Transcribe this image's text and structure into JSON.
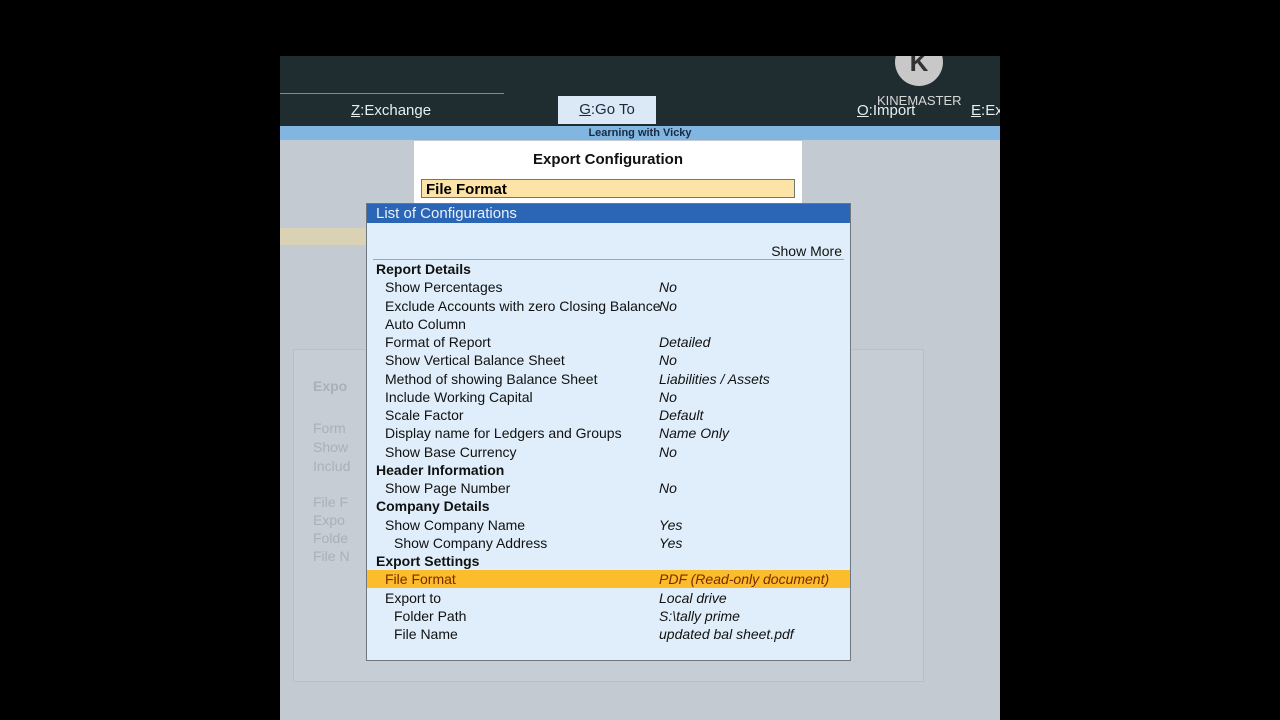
{
  "topbar": {
    "exchange_key": "Z",
    "exchange_label": "Exchange",
    "goto_key": "G",
    "goto_label": "Go To",
    "import_key": "O",
    "import_label": "Import",
    "e_key": "E",
    "e_label": "Ex"
  },
  "watermark": "KINEMASTER",
  "strip_title": "Learning with Vicky",
  "export_config": {
    "title": "Export Configuration",
    "field": "File Format"
  },
  "background_fragments": [
    "Expo",
    "Form",
    "Show",
    "Includ",
    "File F",
    "Expo",
    "Folde",
    "File N"
  ],
  "list": {
    "title": "List of Configurations",
    "show_more": "Show More",
    "rows": [
      {
        "k": "Report Details",
        "v": "",
        "type": "h"
      },
      {
        "k": "Show Percentages",
        "v": "No"
      },
      {
        "k": "Exclude Accounts with zero Closing Balance",
        "v": "No"
      },
      {
        "k": "Auto Column",
        "v": ""
      },
      {
        "k": "Format of Report",
        "v": "Detailed"
      },
      {
        "k": "Show Vertical Balance Sheet",
        "v": "No"
      },
      {
        "k": "Method of showing Balance Sheet",
        "v": "Liabilities / Assets"
      },
      {
        "k": "Include Working Capital",
        "v": "No"
      },
      {
        "k": "Scale Factor",
        "v": "Default"
      },
      {
        "k": "Display name for Ledgers and Groups",
        "v": "Name Only"
      },
      {
        "k": "Show Base Currency",
        "v": "No"
      },
      {
        "k": "Header Information",
        "v": "",
        "type": "h"
      },
      {
        "k": "Show Page Number",
        "v": "No"
      },
      {
        "k": "Company Details",
        "v": "",
        "type": "h"
      },
      {
        "k": "Show Company Name",
        "v": "Yes"
      },
      {
        "k": "Show Company Address",
        "v": "Yes",
        "type": "i2"
      },
      {
        "k": "Export Settings",
        "v": "",
        "type": "h"
      },
      {
        "k": "File Format",
        "v": "PDF (Read-only document)",
        "type": "sel"
      },
      {
        "k": "Export to",
        "v": "Local drive"
      },
      {
        "k": "Folder Path",
        "v": "S:\\tally prime",
        "type": "i2"
      },
      {
        "k": "File Name",
        "v": "updated bal sheet.pdf",
        "type": "i2"
      }
    ]
  }
}
